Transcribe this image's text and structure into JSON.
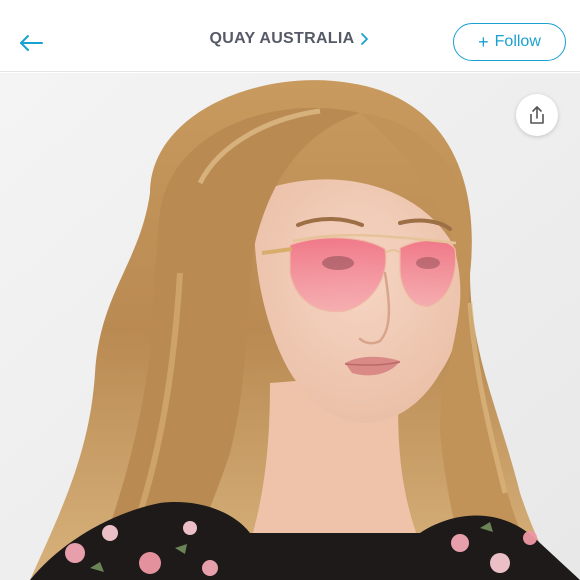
{
  "header": {
    "back_icon": "arrow-left-icon",
    "title": "QUAY AUSTRALIA",
    "title_icon": "chevron-right-icon",
    "follow_label": "Follow",
    "follow_icon": "plus-icon"
  },
  "photo": {
    "share_icon": "share-upload-icon"
  },
  "colors": {
    "accent": "#1aa1d0",
    "title_text": "#555a66",
    "lens": "#f07a8c"
  }
}
